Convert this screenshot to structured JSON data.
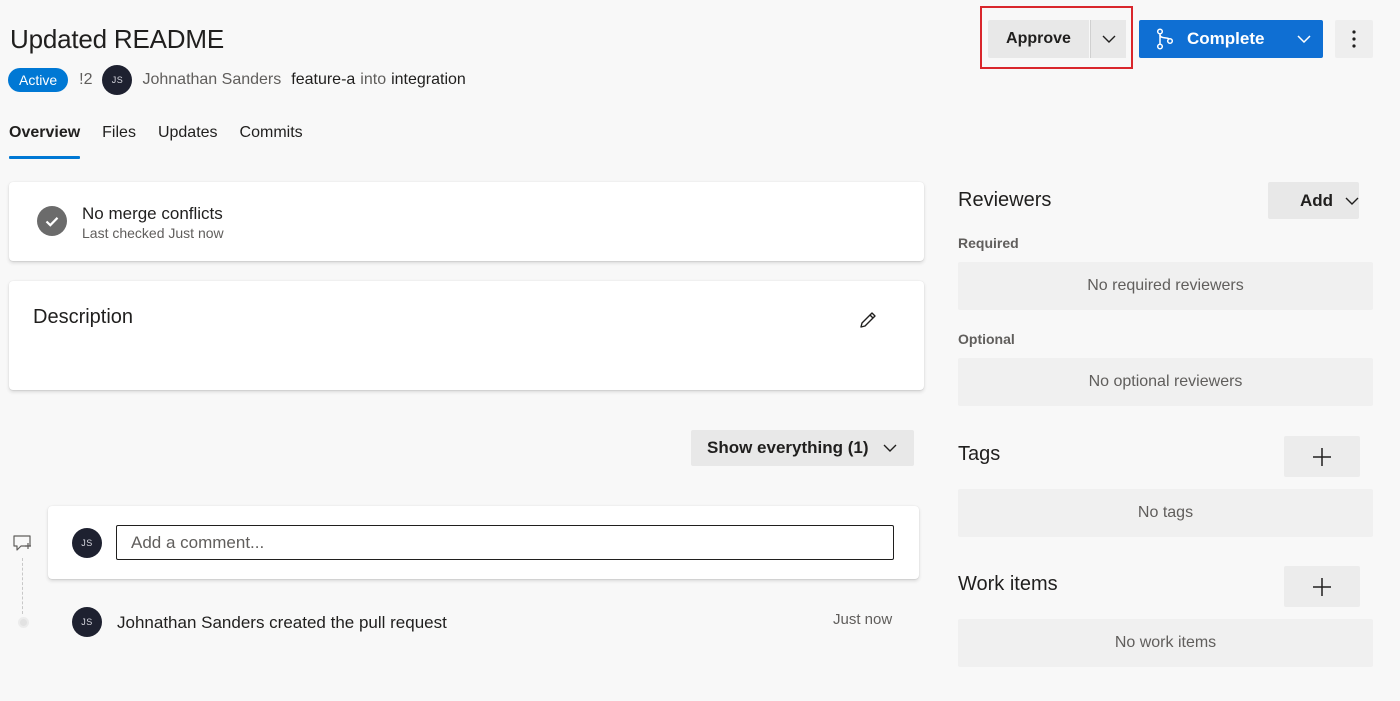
{
  "header": {
    "title": "Updated README",
    "status_badge": "Active",
    "pr_id": "!2",
    "author_initials": "JS",
    "author_name": "Johnathan Sanders",
    "source_branch": "feature-a",
    "into_text": "into",
    "target_branch": "integration"
  },
  "actions": {
    "approve_label": "Approve",
    "complete_label": "Complete",
    "approve_caret_icon": "chevron-down-icon",
    "complete_icon": "branch-merge-icon",
    "more_icon": "more-vertical-icon",
    "highlight_color": "#d9262c",
    "primary_color": "#0f6fd3"
  },
  "tabs": [
    {
      "label": "Overview",
      "active": true
    },
    {
      "label": "Files",
      "active": false
    },
    {
      "label": "Updates",
      "active": false
    },
    {
      "label": "Commits",
      "active": false
    }
  ],
  "merge_status": {
    "title": "No merge conflicts",
    "subtitle": "Last checked Just now",
    "icon": "check-circle-icon"
  },
  "description": {
    "title": "Description",
    "edit_icon": "pencil-icon"
  },
  "filter": {
    "label": "Show everything (1)"
  },
  "comment": {
    "avatar_initials": "JS",
    "placeholder": "Add a comment..."
  },
  "activity": {
    "avatar_initials": "JS",
    "text": "Johnathan Sanders created the pull request",
    "time": "Just now"
  },
  "sidebar": {
    "reviewers_title": "Reviewers",
    "add_label": "Add",
    "required_label": "Required",
    "required_empty": "No required reviewers",
    "optional_label": "Optional",
    "optional_empty": "No optional reviewers",
    "tags_title": "Tags",
    "tags_empty": "No tags",
    "work_items_title": "Work items",
    "work_items_empty": "No work items"
  }
}
